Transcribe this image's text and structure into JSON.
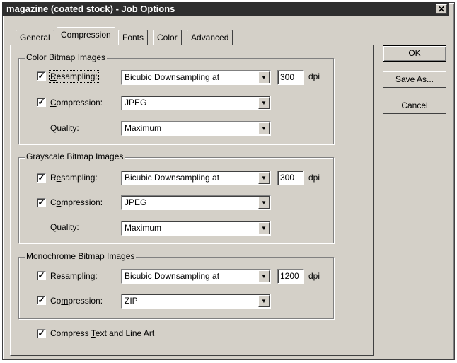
{
  "window": {
    "title": "magazine (coated stock) - Job Options",
    "close_glyph": "✕"
  },
  "tabs": [
    "General",
    "Compression",
    "Fonts",
    "Color",
    "Advanced"
  ],
  "active_tab": "Compression",
  "groups": {
    "color": {
      "title": "Color Bitmap Images",
      "resampling": {
        "checked": true,
        "label_pre": "",
        "label_ul": "R",
        "label_post": "esampling:",
        "method": "Bicubic Downsampling at",
        "dpi": "300",
        "unit": "dpi"
      },
      "compression": {
        "checked": true,
        "label_pre": "",
        "label_ul": "C",
        "label_post": "ompression:",
        "method": "JPEG"
      },
      "quality": {
        "label_pre": "",
        "label_ul": "Q",
        "label_post": "uality:",
        "value": "Maximum"
      }
    },
    "grayscale": {
      "title": "Grayscale Bitmap Images",
      "resampling": {
        "checked": true,
        "label_pre": "R",
        "label_ul": "e",
        "label_post": "sampling:",
        "method": "Bicubic Downsampling at",
        "dpi": "300",
        "unit": "dpi"
      },
      "compression": {
        "checked": true,
        "label_pre": "C",
        "label_ul": "o",
        "label_post": "mpression:",
        "method": "JPEG"
      },
      "quality": {
        "label_pre": "Q",
        "label_ul": "u",
        "label_post": "ality:",
        "value": "Maximum"
      }
    },
    "monochrome": {
      "title": "Monochrome Bitmap Images",
      "resampling": {
        "checked": true,
        "label_pre": "Re",
        "label_ul": "s",
        "label_post": "ampling:",
        "method": "Bicubic Downsampling at",
        "dpi": "1200",
        "unit": "dpi"
      },
      "compression": {
        "checked": true,
        "label_pre": "Co",
        "label_ul": "m",
        "label_post": "pression:",
        "method": "ZIP"
      }
    }
  },
  "compress_text": {
    "checked": true,
    "label_pre": "Compress ",
    "label_ul": "T",
    "label_post": "ext and Line Art"
  },
  "buttons": {
    "ok": "OK",
    "save_as": {
      "pre": "Save ",
      "ul": "A",
      "post": "s..."
    },
    "cancel": "Cancel"
  },
  "check_glyph": "✓",
  "dropdown_glyph": "▼"
}
